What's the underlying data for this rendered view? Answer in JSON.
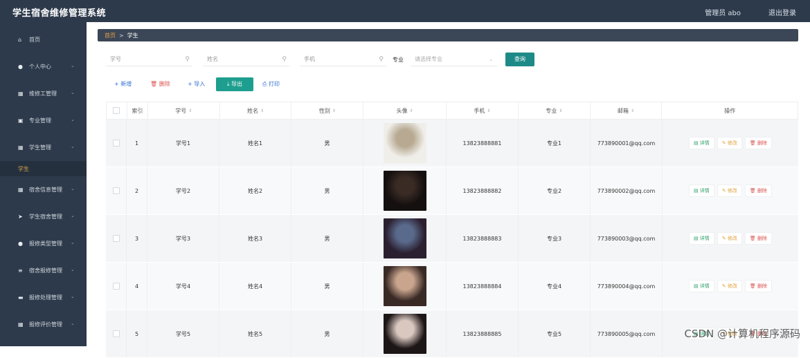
{
  "app": {
    "title": "学生宿舍维修管理系统",
    "user": "管理员 abo",
    "logout": "退出登录"
  },
  "sidebar": {
    "items": [
      {
        "label": "首页",
        "icon": "home-icon"
      },
      {
        "label": "个人中心",
        "icon": "user-icon"
      },
      {
        "label": "维修工管理",
        "icon": "grid-icon"
      },
      {
        "label": "专业管理",
        "icon": "doc-icon"
      },
      {
        "label": "学生管理",
        "icon": "grid-icon"
      },
      {
        "label": "宿舍信息管理",
        "icon": "grid-icon"
      },
      {
        "label": "学生宿舍管理",
        "icon": "send-icon"
      },
      {
        "label": "报修类型管理",
        "icon": "bulb-icon"
      },
      {
        "label": "宿舍报修管理",
        "icon": "list-icon"
      },
      {
        "label": "报修处理管理",
        "icon": "card-icon"
      },
      {
        "label": "报修评价管理",
        "icon": "grid-icon"
      }
    ],
    "active_sub": "学生"
  },
  "breadcrumb": {
    "home": "首页",
    "sep": ">",
    "current": "学生"
  },
  "search": {
    "student_no_placeholder": "学号",
    "name_placeholder": "姓名",
    "phone_placeholder": "手机",
    "major_label": "专业",
    "major_placeholder": "请选择专业",
    "query_label": "查询"
  },
  "actions": {
    "add": "+ 新增",
    "delete": "🗑 删除",
    "import": "+ 导入",
    "export": "⤓ 导出",
    "print": "⎙ 打印"
  },
  "table": {
    "headers": [
      "",
      "索引",
      "学号",
      "姓名",
      "性别",
      "头像",
      "手机",
      "专业",
      "邮箱",
      "操作"
    ],
    "ops": {
      "detail": "▤ 详情",
      "edit": "✎ 修改",
      "delete": "🗑 删除"
    },
    "rows": [
      {
        "index": "1",
        "student_no": "学号1",
        "name": "姓名1",
        "gender": "男",
        "phone": "13823888881",
        "major": "专业1",
        "email": "773890001@qq.com"
      },
      {
        "index": "2",
        "student_no": "学号2",
        "name": "姓名2",
        "gender": "男",
        "phone": "13823888882",
        "major": "专业2",
        "email": "773890002@qq.com"
      },
      {
        "index": "3",
        "student_no": "学号3",
        "name": "姓名3",
        "gender": "男",
        "phone": "13823888883",
        "major": "专业3",
        "email": "773890003@qq.com"
      },
      {
        "index": "4",
        "student_no": "学号4",
        "name": "姓名4",
        "gender": "男",
        "phone": "13823888884",
        "major": "专业4",
        "email": "773890004@qq.com"
      },
      {
        "index": "5",
        "student_no": "学号5",
        "name": "姓名5",
        "gender": "男",
        "phone": "13823888885",
        "major": "专业5",
        "email": "773890005@qq.com"
      }
    ]
  },
  "watermark": "CSDN @计算机程序源码",
  "colors": {
    "sidebar": "#2d3a4b",
    "accent": "#1e8a87",
    "breadcrumb": "#3b4656"
  }
}
